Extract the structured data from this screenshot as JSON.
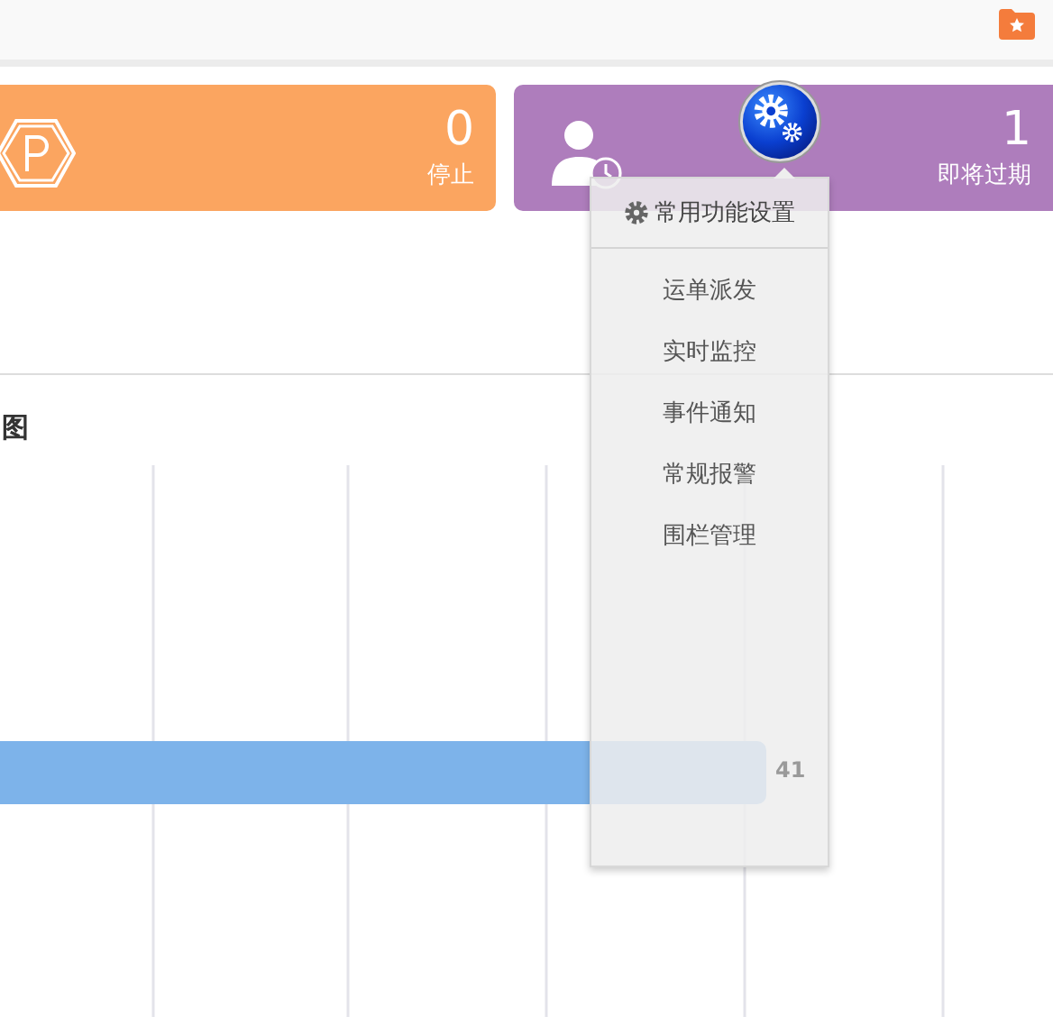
{
  "cards": [
    {
      "kind": "parking",
      "value": "0",
      "label": "停止",
      "color": "#fba560"
    },
    {
      "kind": "user-clock",
      "value": "1",
      "label": "即将过期",
      "color": "#ae7dbc"
    }
  ],
  "settings_menu": {
    "title": "常用功能设置",
    "items": [
      "运单派发",
      "实时监控",
      "事件通知",
      "常规报警",
      "围栏管理"
    ]
  },
  "chart": {
    "title": "图",
    "value_label": "41"
  }
}
